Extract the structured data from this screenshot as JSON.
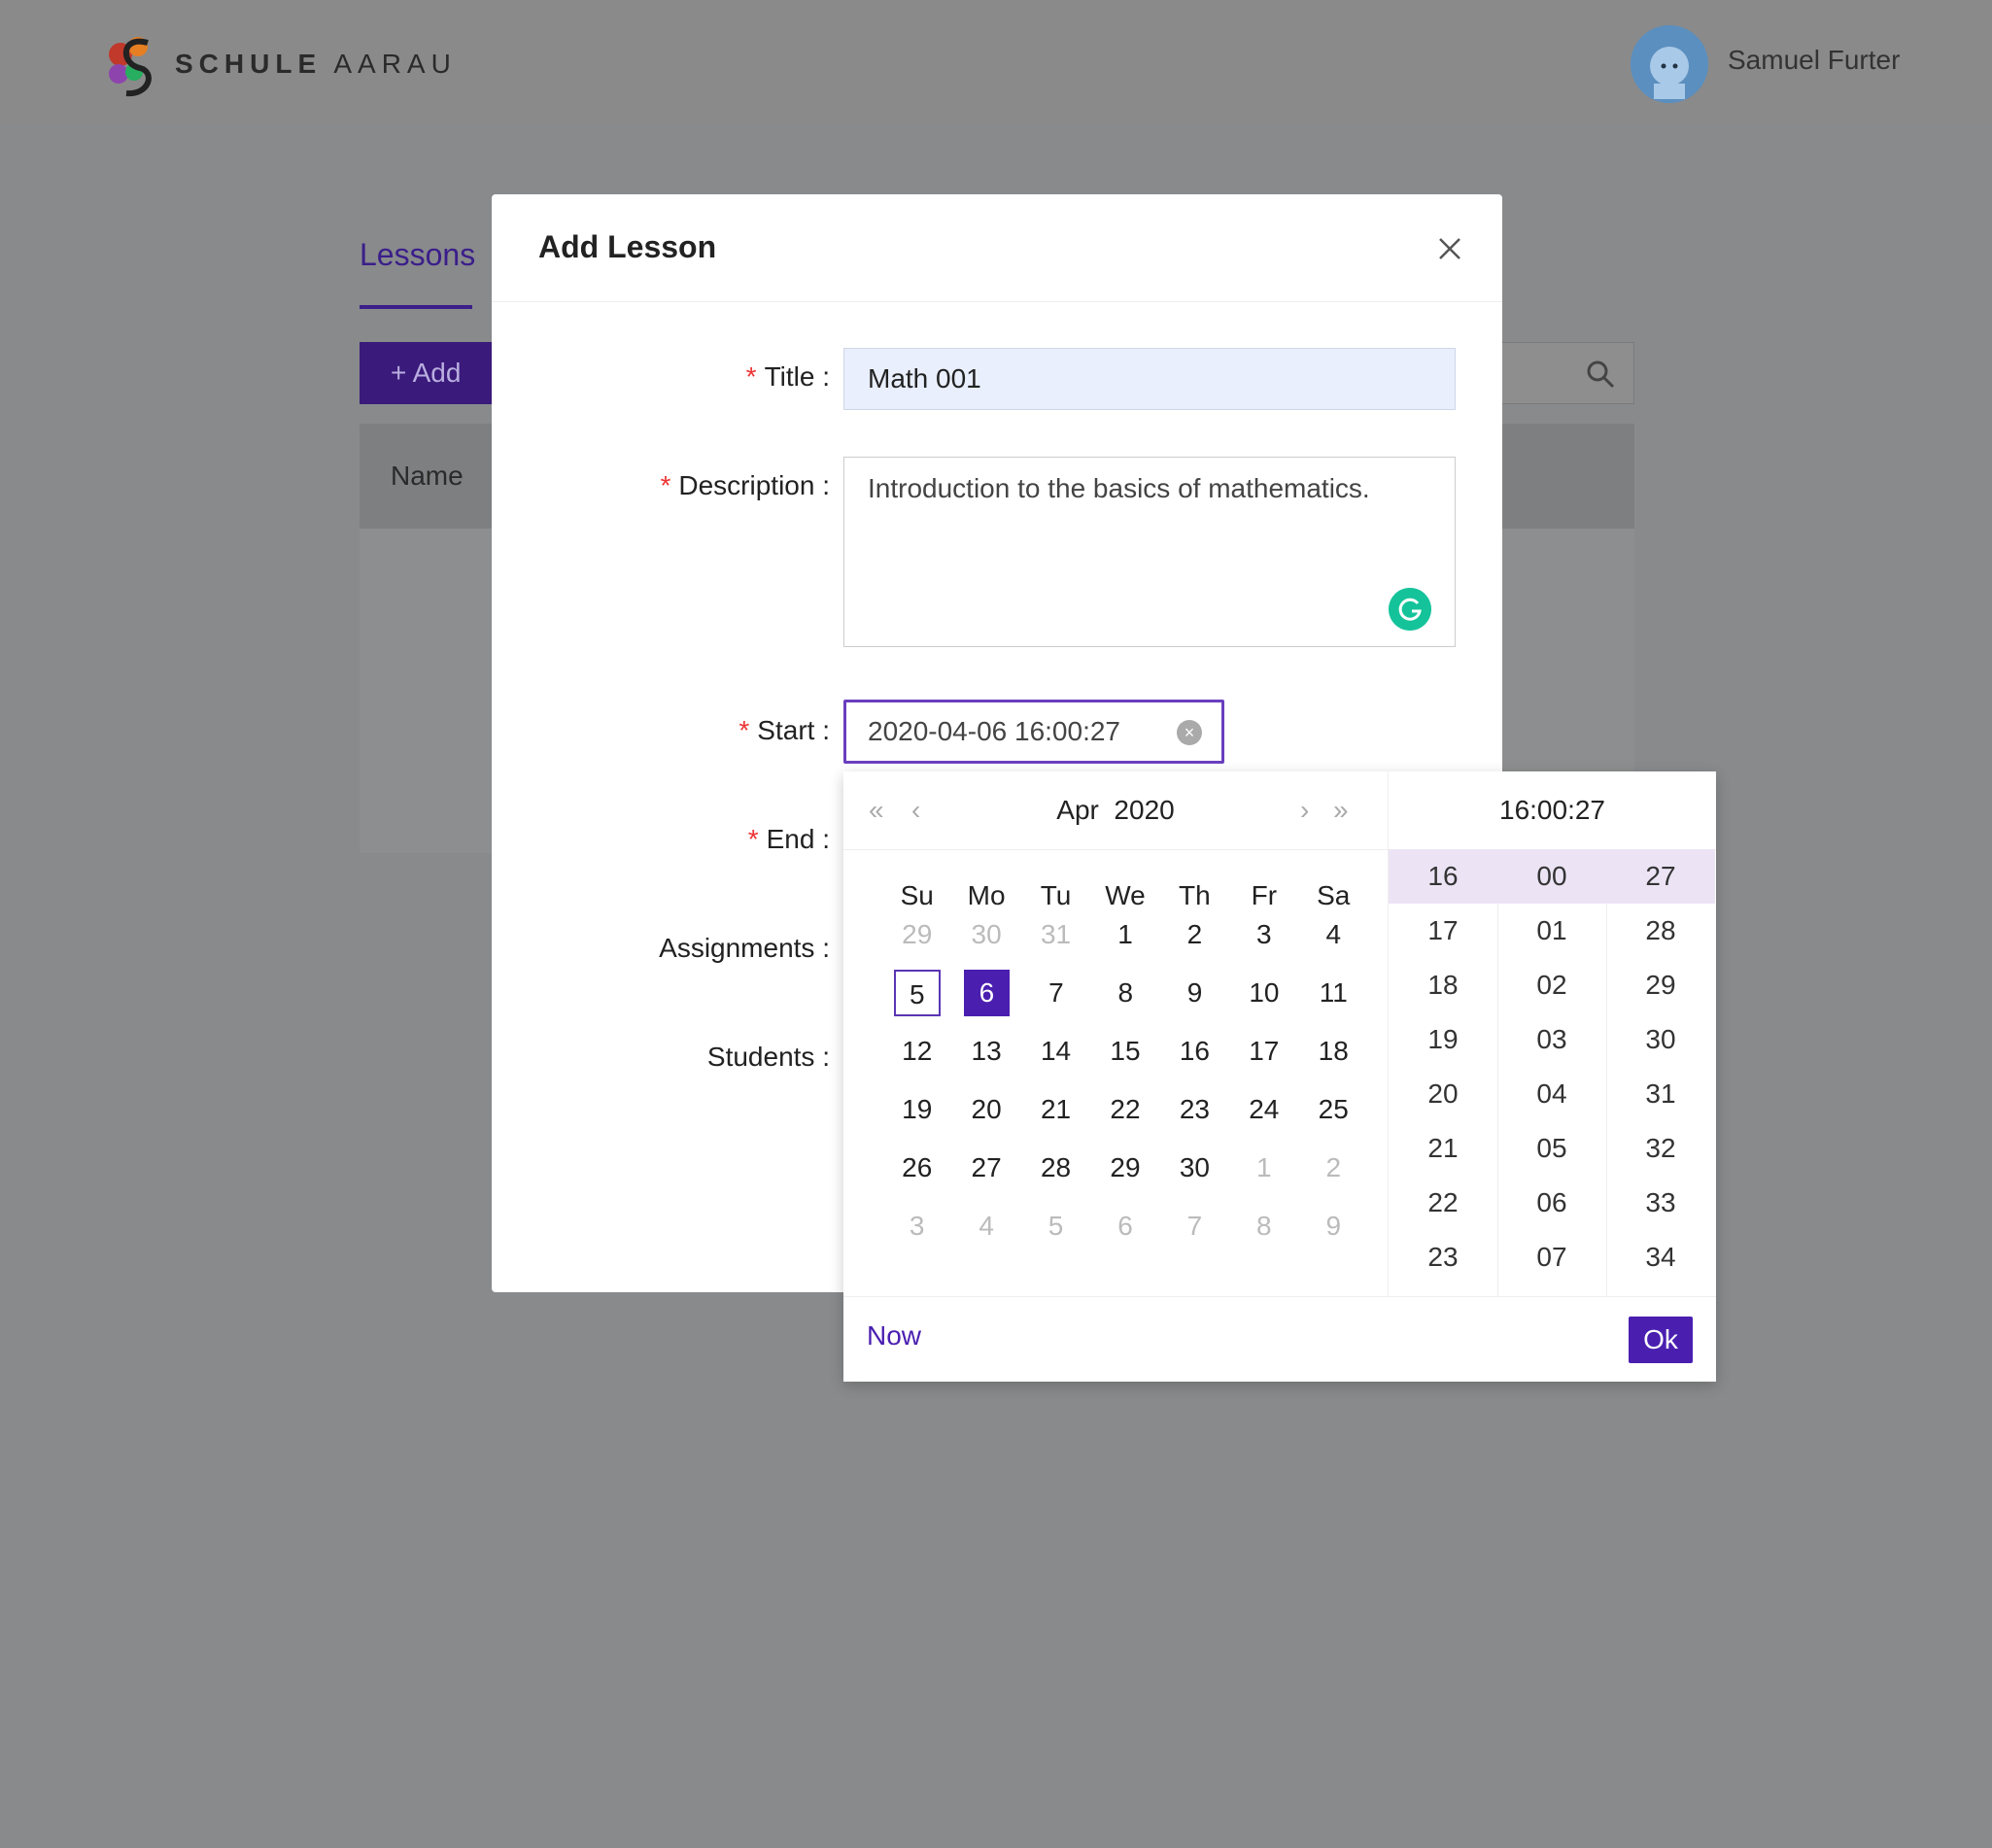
{
  "header": {
    "brand_bold": "SCHULE",
    "brand_light": "AARAU",
    "user_name": "Samuel Furter"
  },
  "page": {
    "tab_lessons": "Lessons",
    "add_button": "Add",
    "column_name": "Name"
  },
  "modal": {
    "title": "Add Lesson",
    "labels": {
      "title": "Title",
      "description": "Description",
      "start": "Start",
      "end": "End",
      "assignments": "Assignments",
      "students": "Students"
    },
    "title_value": "Math 001",
    "description_value": "Introduction to the basics of mathematics.",
    "start_value": "2020-04-06 16:00:27"
  },
  "picker": {
    "month": "Apr",
    "year": "2020",
    "weekdays": [
      "Su",
      "Mo",
      "Tu",
      "We",
      "Th",
      "Fr",
      "Sa"
    ],
    "weeks": [
      [
        "29",
        "30",
        "31",
        "1",
        "2",
        "3",
        "4"
      ],
      [
        "5",
        "6",
        "7",
        "8",
        "9",
        "10",
        "11"
      ],
      [
        "12",
        "13",
        "14",
        "15",
        "16",
        "17",
        "18"
      ],
      [
        "19",
        "20",
        "21",
        "22",
        "23",
        "24",
        "25"
      ],
      [
        "26",
        "27",
        "28",
        "29",
        "30",
        "1",
        "2"
      ],
      [
        "3",
        "4",
        "5",
        "6",
        "7",
        "8",
        "9"
      ]
    ],
    "time_display": "16:00:27",
    "hours": [
      "16",
      "17",
      "18",
      "19",
      "20",
      "21",
      "22",
      "23"
    ],
    "minutes": [
      "00",
      "01",
      "02",
      "03",
      "04",
      "05",
      "06",
      "07"
    ],
    "seconds": [
      "27",
      "28",
      "29",
      "30",
      "31",
      "32",
      "33",
      "34"
    ],
    "now_label": "Now",
    "ok_label": "Ok"
  },
  "colors": {
    "accent": "#4a1fb0",
    "required": "#e33333"
  }
}
